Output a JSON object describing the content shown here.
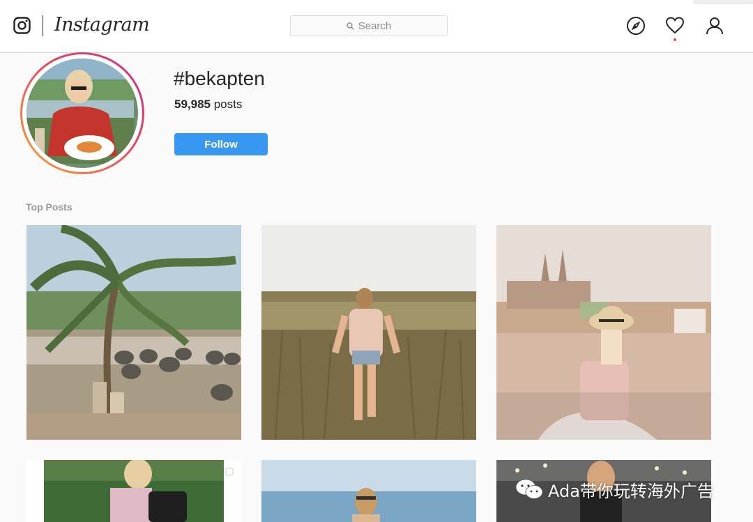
{
  "header": {
    "wordmark": "Instagram",
    "search_placeholder": "Search"
  },
  "profile": {
    "hashtag": "#bekapten",
    "post_count": "59,985",
    "post_suffix": " posts",
    "follow_label": "Follow"
  },
  "sections": {
    "top_posts": "Top Posts"
  },
  "watermark": {
    "text": "Ada带你玩转海外广告"
  },
  "colors": {
    "accent": "#3897f0",
    "notification": "#ed4956"
  },
  "icons": [
    "instagram-glyph-icon",
    "search-icon",
    "compass-icon",
    "heart-icon",
    "user-icon",
    "wechat-icon"
  ]
}
